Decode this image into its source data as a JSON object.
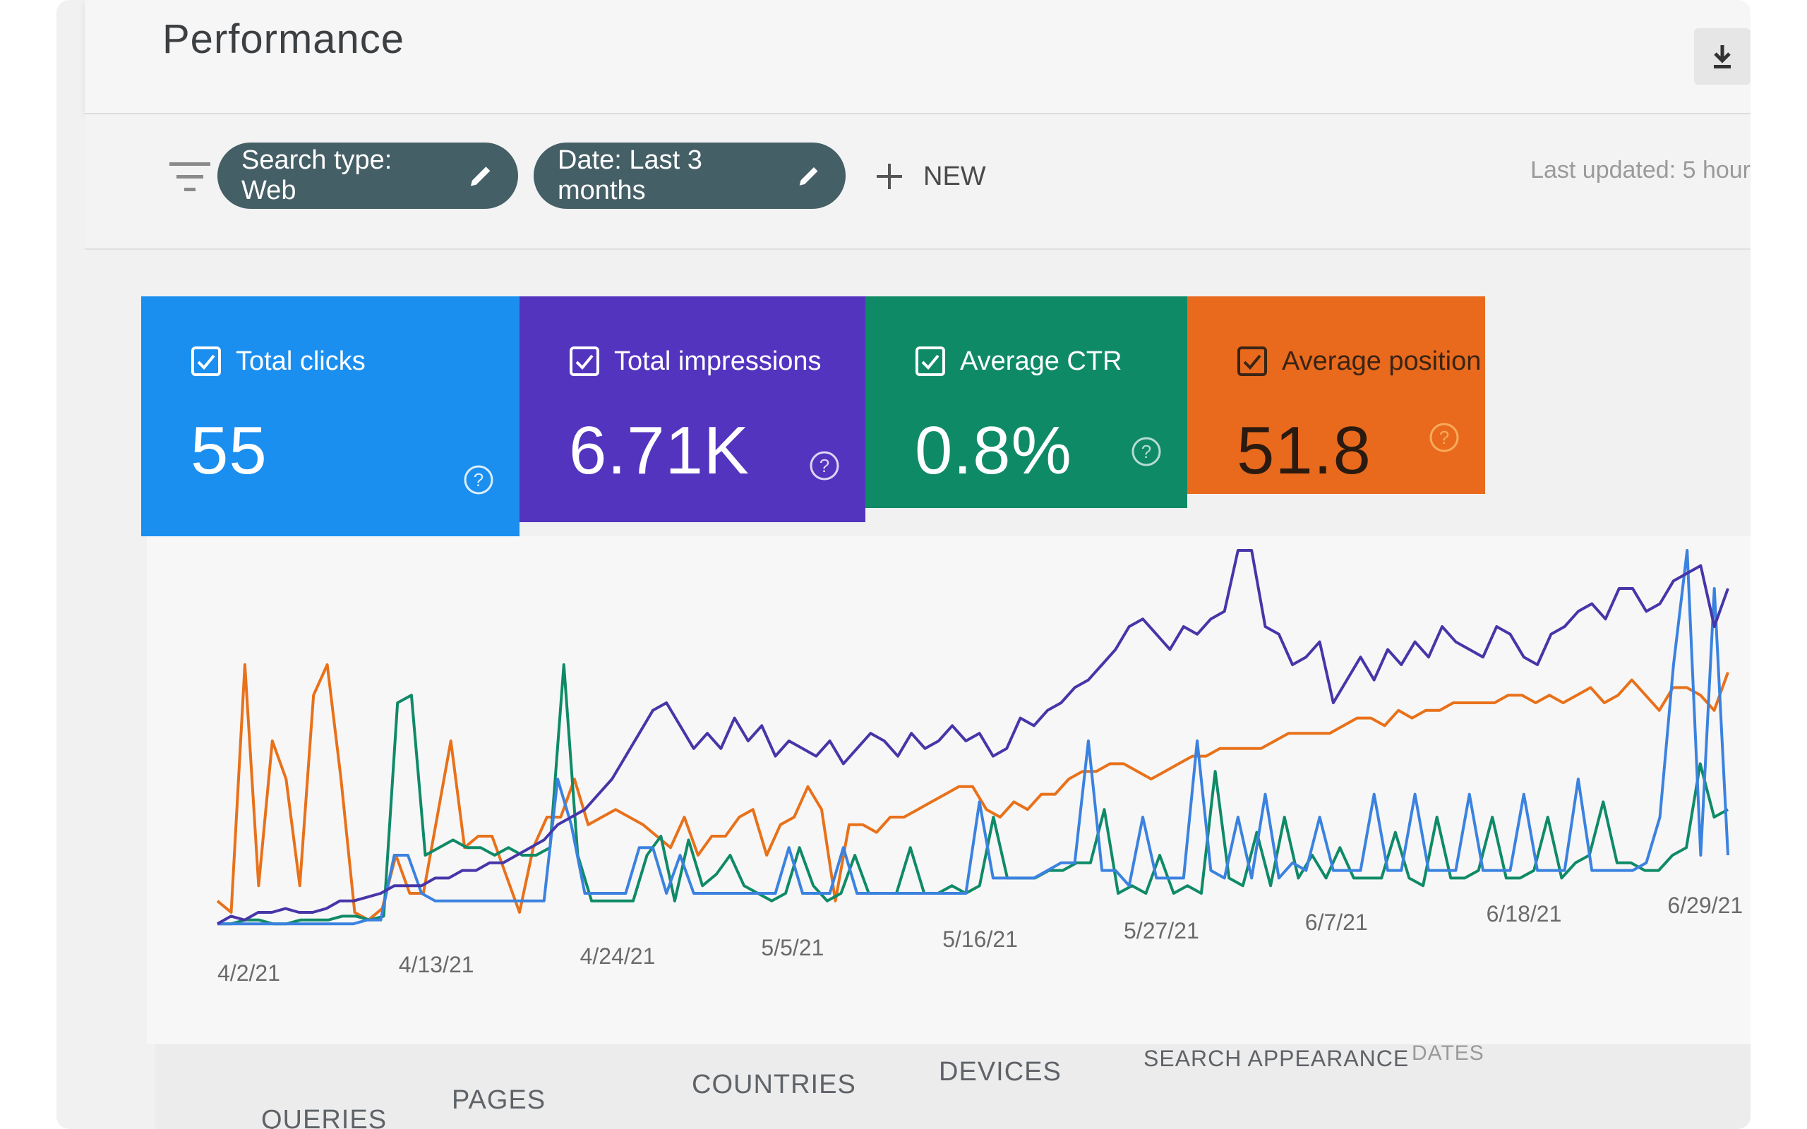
{
  "header": {
    "title": "Performance"
  },
  "filters": {
    "search_type": "Search type: Web",
    "date": "Date: Last 3 months",
    "new_label": "NEW",
    "last_updated": "Last updated: 5 hour"
  },
  "metrics": [
    {
      "label": "Total clicks",
      "value": "55",
      "color": "#1a8ff0"
    },
    {
      "label": "Total impressions",
      "value": "6.71K",
      "color": "#5334bf"
    },
    {
      "label": "Average CTR",
      "value": "0.8%",
      "color": "#0f8a67"
    },
    {
      "label": "Average position",
      "value": "51.8",
      "color": "#e96a1d"
    }
  ],
  "chart_data": {
    "type": "line",
    "x_ticks": [
      "4/2/21",
      "4/13/21",
      "4/24/21",
      "5/5/21",
      "5/16/21",
      "5/27/21",
      "6/7/21",
      "6/18/21",
      "6/29/21"
    ],
    "ylim": [
      0,
      100
    ],
    "grid": false,
    "series": [
      {
        "color": "#e8711a",
        "values": [
          8,
          5,
          70,
          12,
          50,
          40,
          12,
          62,
          70,
          40,
          5,
          3,
          6,
          20,
          10,
          10,
          30,
          50,
          22,
          25,
          25,
          15,
          5,
          22,
          30,
          30,
          40,
          28,
          30,
          32,
          30,
          28,
          25,
          22,
          30,
          20,
          25,
          25,
          30,
          32,
          20,
          28,
          30,
          38,
          32,
          8,
          28,
          28,
          26,
          30,
          30,
          32,
          34,
          36,
          38,
          38,
          32,
          30,
          34,
          32,
          36,
          36,
          40,
          42,
          42,
          44,
          44,
          42,
          40,
          42,
          44,
          46,
          46,
          48,
          48,
          48,
          48,
          50,
          52,
          52,
          52,
          52,
          54,
          56,
          56,
          54,
          58,
          56,
          58,
          58,
          60,
          60,
          60,
          60,
          62,
          62,
          60,
          62,
          60,
          62,
          64,
          60,
          62,
          66,
          62,
          58,
          64,
          64,
          62,
          58,
          68
        ]
      },
      {
        "color": "#0f8a67",
        "values": [
          2,
          2,
          3,
          3,
          2,
          2,
          3,
          3,
          3,
          4,
          4,
          3,
          4,
          60,
          62,
          20,
          22,
          24,
          22,
          22,
          20,
          22,
          20,
          20,
          22,
          70,
          20,
          8,
          8,
          8,
          8,
          20,
          25,
          8,
          24,
          12,
          15,
          20,
          12,
          10,
          8,
          10,
          22,
          12,
          8,
          10,
          20,
          10,
          10,
          10,
          22,
          10,
          10,
          12,
          10,
          12,
          30,
          14,
          14,
          14,
          16,
          16,
          18,
          18,
          32,
          10,
          12,
          10,
          20,
          10,
          12,
          10,
          42,
          14,
          12,
          26,
          12,
          30,
          14,
          20,
          14,
          22,
          14,
          14,
          14,
          26,
          14,
          12,
          30,
          14,
          14,
          16,
          30,
          14,
          14,
          16,
          30,
          14,
          18,
          20,
          34,
          18,
          18,
          16,
          16,
          20,
          22,
          44,
          30,
          32
        ]
      },
      {
        "color": "#3b82e0",
        "values": [
          2,
          2,
          2,
          2,
          2,
          2,
          2,
          2,
          2,
          2,
          2,
          3,
          3,
          20,
          20,
          10,
          8,
          8,
          8,
          8,
          8,
          8,
          8,
          8,
          8,
          40,
          28,
          10,
          10,
          10,
          10,
          22,
          22,
          10,
          20,
          10,
          10,
          10,
          10,
          10,
          10,
          10,
          22,
          10,
          10,
          10,
          22,
          10,
          10,
          10,
          10,
          10,
          10,
          10,
          10,
          10,
          34,
          14,
          14,
          14,
          14,
          16,
          18,
          18,
          50,
          16,
          16,
          12,
          30,
          14,
          14,
          14,
          50,
          16,
          14,
          30,
          14,
          36,
          14,
          18,
          16,
          30,
          16,
          16,
          16,
          36,
          16,
          16,
          36,
          16,
          16,
          16,
          36,
          16,
          16,
          16,
          36,
          16,
          16,
          16,
          40,
          16,
          16,
          16,
          16,
          18,
          30,
          70,
          100,
          20,
          90,
          20
        ]
      },
      {
        "color": "#4636a8",
        "values": [
          2,
          4,
          3,
          5,
          5,
          6,
          5,
          5,
          6,
          8,
          8,
          9,
          10,
          12,
          12,
          12,
          14,
          14,
          16,
          16,
          18,
          18,
          20,
          22,
          24,
          28,
          30,
          32,
          36,
          40,
          46,
          52,
          58,
          60,
          54,
          48,
          52,
          48,
          56,
          50,
          54,
          46,
          50,
          48,
          46,
          50,
          44,
          48,
          52,
          50,
          46,
          52,
          48,
          50,
          54,
          50,
          52,
          46,
          48,
          56,
          54,
          58,
          60,
          64,
          66,
          70,
          74,
          80,
          82,
          78,
          74,
          80,
          78,
          82,
          84,
          100,
          100,
          80,
          78,
          70,
          72,
          76,
          60,
          66,
          72,
          66,
          74,
          70,
          76,
          72,
          80,
          76,
          74,
          72,
          80,
          78,
          72,
          70,
          78,
          80,
          84,
          86,
          82,
          90,
          90,
          84,
          86,
          92,
          94,
          96,
          80,
          90
        ]
      }
    ]
  },
  "tabs": [
    "QUERIES",
    "PAGES",
    "COUNTRIES",
    "DEVICES",
    "SEARCH APPEARANCE",
    "DATES"
  ]
}
